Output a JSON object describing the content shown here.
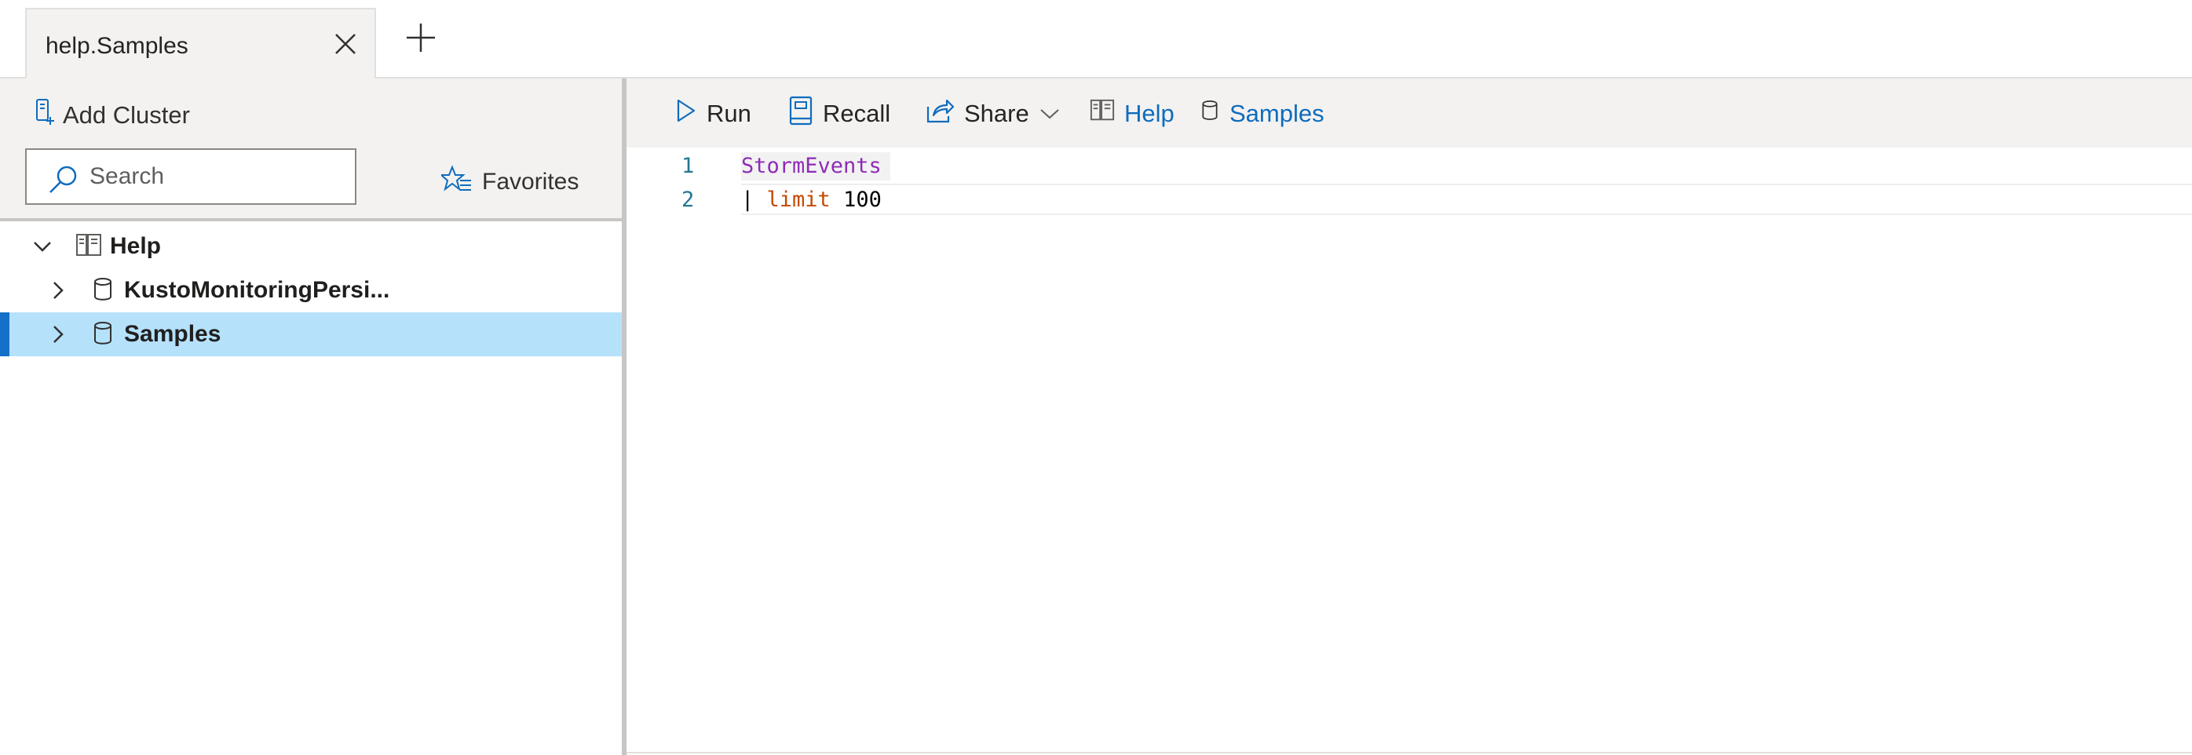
{
  "tab": {
    "title": "help.Samples"
  },
  "left_pane": {
    "add_cluster_label": "Add Cluster",
    "search": {
      "placeholder": "Search",
      "value": ""
    },
    "favorites_label": "Favorites",
    "tree": [
      {
        "label": "Help",
        "expanded": true,
        "selected": false,
        "icon": "cluster-icon"
      },
      {
        "label": "KustoMonitoringPersi...",
        "expanded": false,
        "selected": false,
        "icon": "database-icon"
      },
      {
        "label": "Samples",
        "expanded": false,
        "selected": true,
        "icon": "database-icon"
      }
    ]
  },
  "toolbar": {
    "run_label": "Run",
    "recall_label": "Recall",
    "share_label": "Share",
    "help_label": "Help",
    "samples_label": "Samples"
  },
  "editor": {
    "lines": [
      {
        "number": "1",
        "tokens": {
          "table": "StormEvents"
        }
      },
      {
        "number": "2",
        "tokens": {
          "pipe": "|",
          "operator": "limit",
          "value": "100"
        }
      }
    ]
  },
  "colors": {
    "accent": "#0f6cbd",
    "selection": "#b5e1fb",
    "selection_bar": "#1570c7",
    "table_token": "#8e2cb5",
    "operator_token": "#c34a00",
    "line_number": "#237893"
  }
}
